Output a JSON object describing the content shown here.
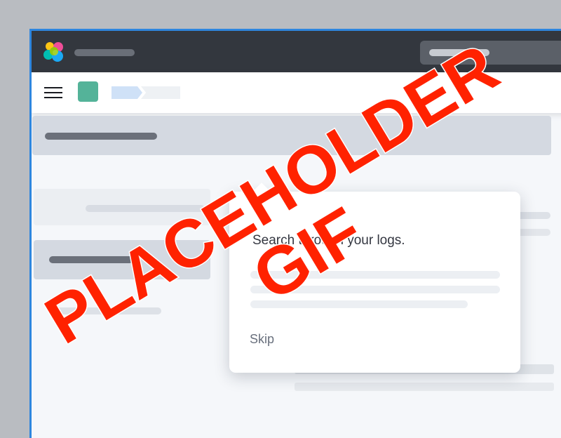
{
  "tour": {
    "message": "Search through your logs.",
    "skip_label": "Skip"
  },
  "watermark": {
    "line1": "PLACEHOLDER",
    "line2": "GIF",
    "color": "#ff2200"
  },
  "colors": {
    "header_bg": "#33373e",
    "accent_border": "#2e86de",
    "space_avatar": "#54b399",
    "breadcrumb_active": "#cfe1f7"
  },
  "icons": {
    "logo": "elastic-logo-icon",
    "menu": "hamburger-menu-icon"
  }
}
